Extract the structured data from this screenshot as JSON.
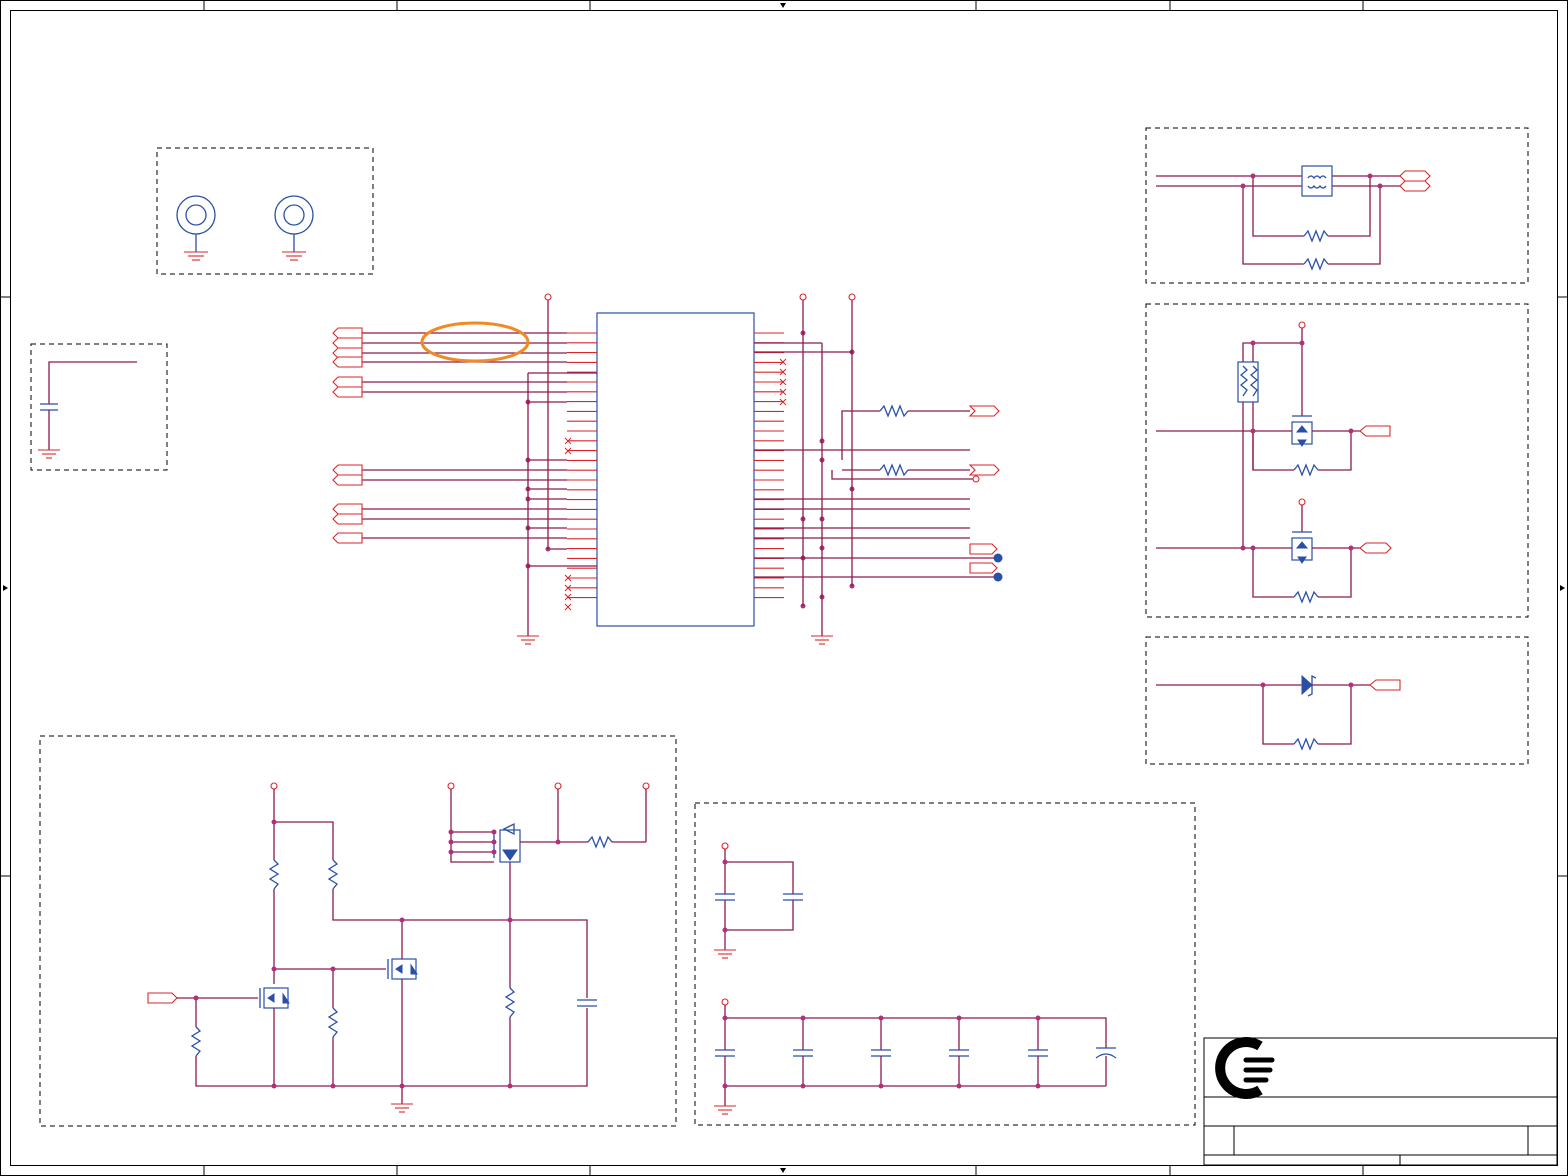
{
  "schematic": {
    "title_block": {
      "logo": "company-logo"
    },
    "colors": {
      "wire": "#8a1a4e",
      "net_label": "#d9262b",
      "component": "#2a4fa6",
      "highlight": "#f08a24",
      "junction": "#b0307a"
    },
    "blocks": [
      "mounting-holes",
      "decoupling-left",
      "main-connector",
      "esd-filter",
      "level-shifter",
      "reverse-diode",
      "power-switch",
      "bulk-capacitors"
    ]
  }
}
